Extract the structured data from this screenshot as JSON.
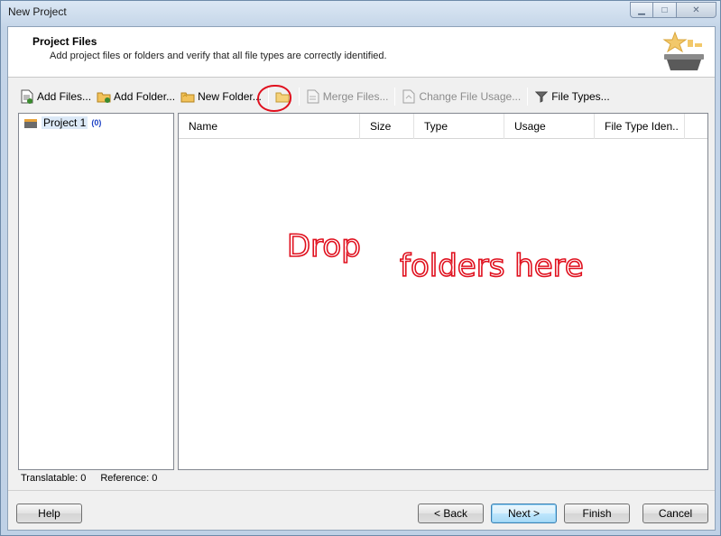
{
  "window": {
    "title": "New Project",
    "controls": {
      "minimize": "▁",
      "maximize": "□",
      "close": "✕"
    }
  },
  "header": {
    "title": "Project Files",
    "subtitle": "Add project files or folders and verify that all file types are correctly identified.",
    "logo_icon": "star-basket-icon"
  },
  "toolbar": {
    "add_files": "Add Files...",
    "add_folder": "Add Folder...",
    "new_folder": "New Folder...",
    "open_folder_icon": "folder-icon",
    "merge_files": "Merge Files...",
    "change_file_usage": "Change File Usage...",
    "file_types": "File Types..."
  },
  "tree": {
    "items": [
      {
        "label": "Project 1",
        "count": "(0)",
        "icon": "project-icon"
      }
    ]
  },
  "grid": {
    "columns": [
      "Name",
      "Size",
      "Type",
      "Usage",
      "File Type Iden.."
    ]
  },
  "annotation": {
    "line1": "Drop",
    "line2": "folders here"
  },
  "status": {
    "translatable": "Translatable: 0",
    "reference": "Reference: 0"
  },
  "buttons": {
    "help": "Help",
    "back": "< Back",
    "next": "Next >",
    "finish": "Finish",
    "cancel": "Cancel"
  },
  "colors": {
    "annotation_red": "#e0101e",
    "selection": "#dce9f7",
    "count_blue": "#1a3fc4"
  }
}
